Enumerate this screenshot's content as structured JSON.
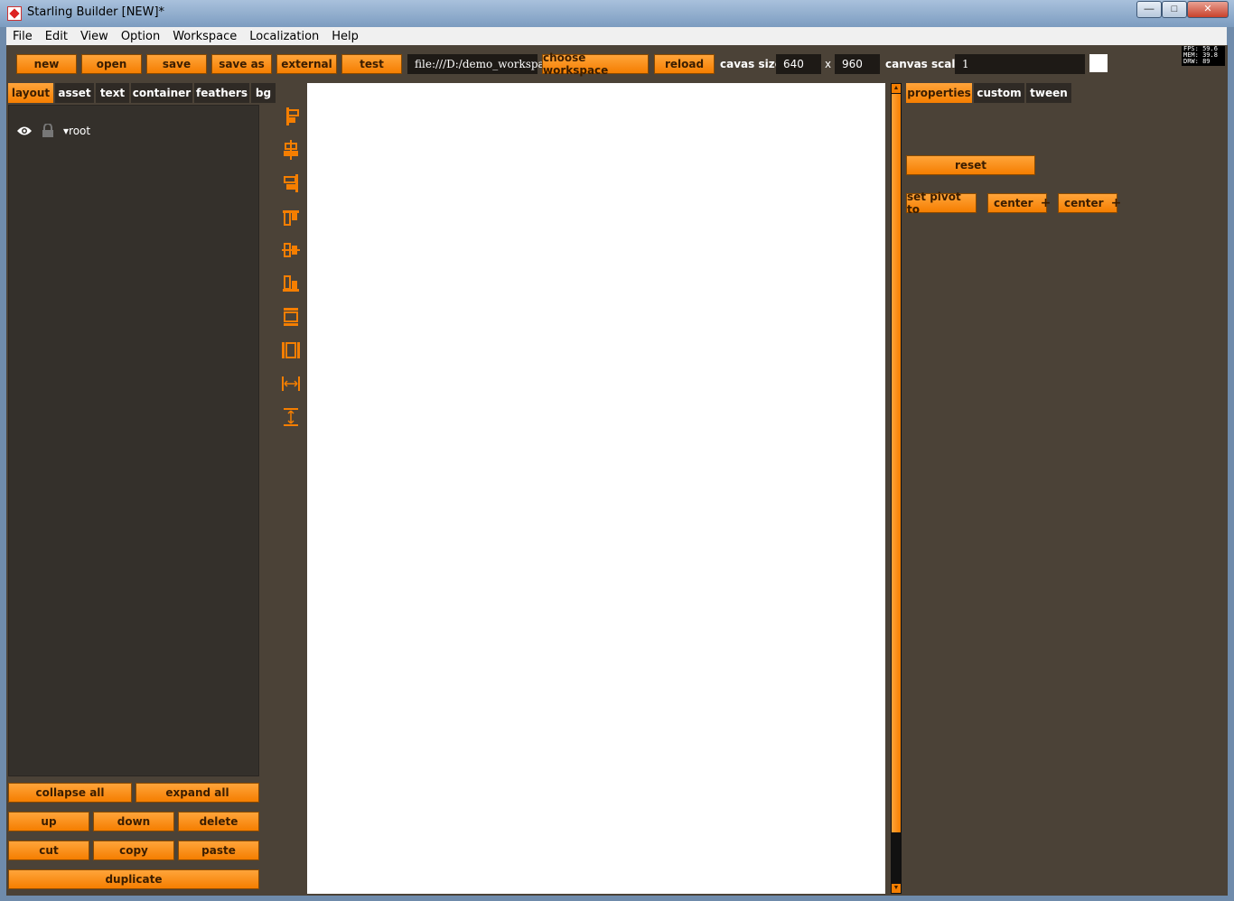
{
  "window": {
    "title": "Starling Builder [NEW]*",
    "minimize": "—",
    "maximize": "□",
    "close": "✕"
  },
  "menu": [
    "File",
    "Edit",
    "View",
    "Option",
    "Workspace",
    "Localization",
    "Help"
  ],
  "toolbar": {
    "buttons": [
      "new",
      "open",
      "save",
      "save as",
      "external",
      "test"
    ],
    "workspace_path": "file:///D:/demo_workspa",
    "choose_workspace": "choose workspace",
    "reload": "reload",
    "canvas_size_label": "cavas size:",
    "canvas_width": "640",
    "x_label": "x",
    "canvas_height": "960",
    "canvas_scale_label": "canvas scale:",
    "canvas_scale": "1",
    "stats": {
      "fps": "FPS: 59.6",
      "mem": "MEM: 39.8",
      "drw": "DRW: 89"
    }
  },
  "left_tabs": [
    "layout",
    "asset",
    "text",
    "container",
    "feathers",
    "bg"
  ],
  "active_left_tab": "layout",
  "tree": {
    "root_label": "▾root"
  },
  "tree_actions": {
    "collapse_all": "collapse all",
    "expand_all": "expand all",
    "up": "up",
    "down": "down",
    "delete": "delete",
    "cut": "cut",
    "copy": "copy",
    "paste": "paste",
    "duplicate": "duplicate"
  },
  "align_tools": [
    "align-left-icon",
    "align-center-horizontal-icon",
    "align-right-icon",
    "align-top-icon",
    "align-center-vertical-icon",
    "align-bottom-icon",
    "distribute-vertical-icon",
    "distribute-horizontal-icon",
    "space-horizontal-icon",
    "space-vertical-icon"
  ],
  "right_tabs": [
    "properties",
    "custom",
    "tween"
  ],
  "active_right_tab": "properties",
  "properties": {
    "reset": "reset",
    "set_pivot_to": "set pivot to",
    "pivot_x": "center",
    "pivot_y": "center"
  },
  "colors": {
    "accent": "#f57e00",
    "panel": "#4b4237",
    "dark": "#34302b"
  }
}
